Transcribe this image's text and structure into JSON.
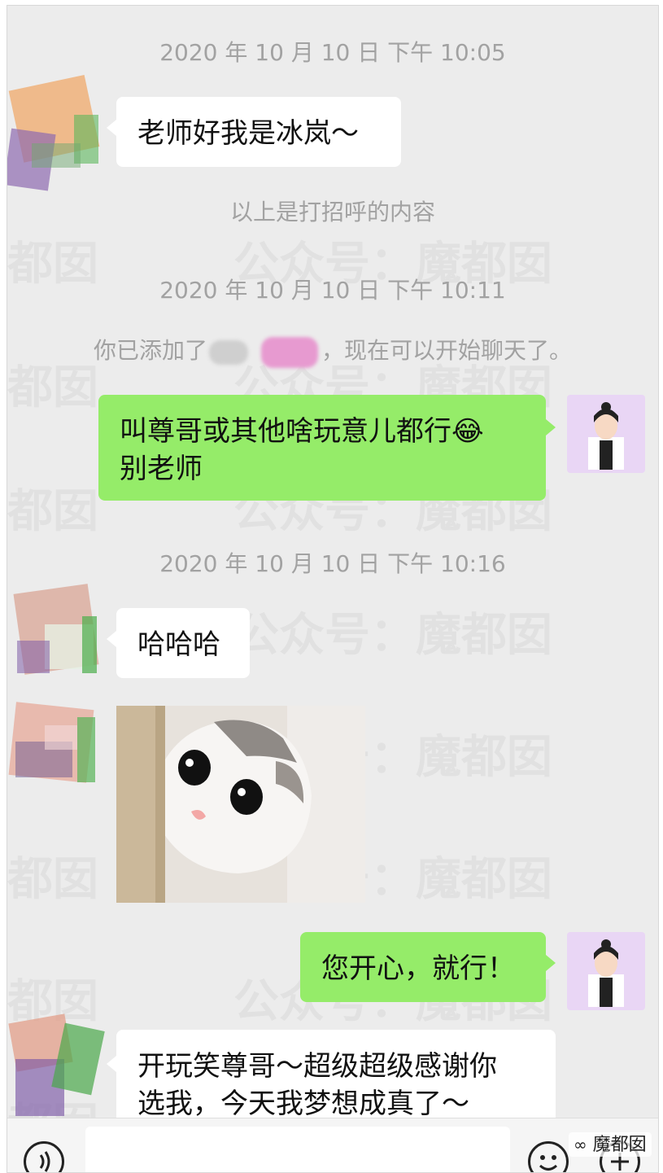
{
  "watermark": {
    "main": "公众号：魔都囡",
    "short": "都囡"
  },
  "chat": {
    "ts1": "2020 年 10 月 10 日  下午 10:05",
    "msg1": "老师好我是冰岚～",
    "sys1": "以上是打招呼的内容",
    "ts2": "2020 年 10 月 10 日  下午 10:11",
    "sys2_prefix": "你已添加了",
    "sys2_suffix": "，现在可以开始聊天了。",
    "msg2_line1": "叫尊哥或其他啥玩意儿都行😂",
    "msg2_line2": "别老师",
    "ts3": "2020 年 10 月 10 日  下午 10:16",
    "msg3": "哈哈哈",
    "msg5": "您开心，就行！",
    "msg6_line1": "开玩笑尊哥～超级超级感谢你",
    "msg6_line2": "选我，今天我梦想成真了～"
  },
  "corner_watermark": "魔都囡",
  "icons": {
    "voice": "voice-icon",
    "emoji": "emoji-icon",
    "plus": "plus-icon"
  },
  "colors": {
    "background": "#ececec",
    "incoming_bubble": "#ffffff",
    "outgoing_bubble": "#95ec69",
    "system_text": "#a2a2a2"
  }
}
